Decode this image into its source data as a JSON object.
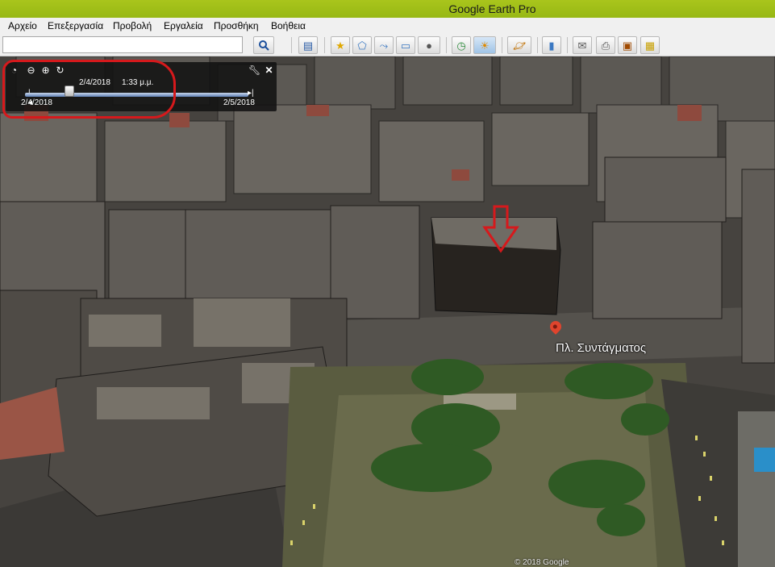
{
  "window": {
    "title": "Google Earth Pro"
  },
  "menu": {
    "items": [
      "Αρχείο",
      "Επεξεργασία",
      "Προβολή",
      "Εργαλεία",
      "Προσθήκη",
      "Βοήθεια"
    ]
  },
  "toolbar": {
    "search_value": "",
    "buttons": [
      "search-icon",
      "sidebar-icon",
      "placemark-icon",
      "polygon-icon",
      "path-icon",
      "image-overlay-icon",
      "record-tour-icon",
      "historical-imagery-icon",
      "sunlight-icon",
      "planets-icon",
      "ruler-icon",
      "email-icon",
      "print-icon",
      "save-image-icon",
      "maps-icon"
    ]
  },
  "time_slider": {
    "current_date": "2/4/2018",
    "current_time": "1:33 μ.μ.",
    "start_date": "2/4/2018",
    "end_date": "2/5/2018",
    "position_fraction": 0.2
  },
  "map": {
    "placemark_label": "Πλ. Συντάγματος",
    "copyright": "© 2018 Google"
  },
  "colors": {
    "titlebar": "#a9c51c",
    "annotation": "#d6191c",
    "pin": "#e0442d"
  }
}
